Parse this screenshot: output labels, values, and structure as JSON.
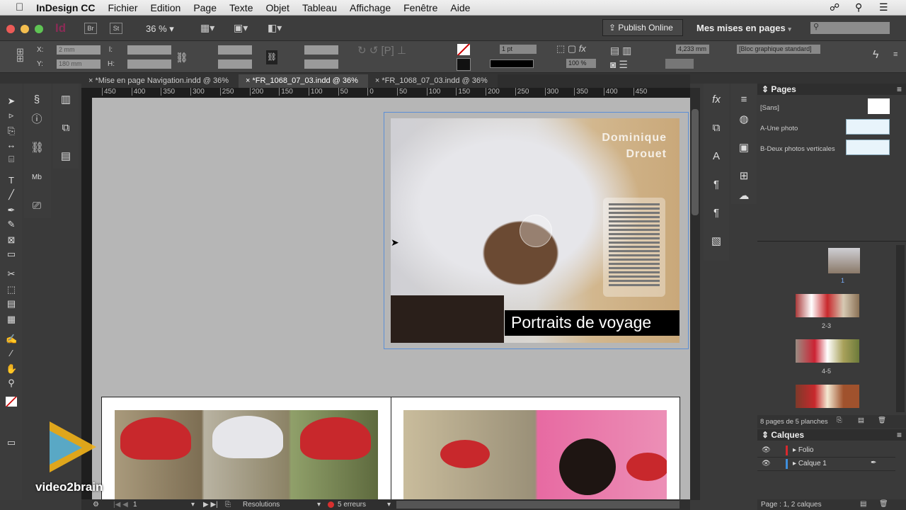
{
  "menubar": {
    "app": "InDesign CC",
    "items": [
      "Fichier",
      "Edition",
      "Page",
      "Texte",
      "Objet",
      "Tableau",
      "Affichage",
      "Fenêtre",
      "Aide"
    ]
  },
  "appbar": {
    "id_logo": "Id",
    "bridge": "Br",
    "stock": "St",
    "zoom": "36 %",
    "publish": "Publish Online",
    "workspace": "Mes mises en pages",
    "search_placeholder": ""
  },
  "control": {
    "x_label": "X:",
    "x": "2 mm",
    "y_label": "Y:",
    "y": "180 mm",
    "w_label": "l:",
    "h_label": "H:",
    "stroke_weight": "1 pt",
    "opacity": "100 %",
    "offset": "4,233 mm",
    "object_style": "[Bloc graphique standard]"
  },
  "tabs": [
    {
      "label": "*Mise en page Navigation.indd @ 36%",
      "active": false
    },
    {
      "label": "*FR_1068_07_03.indd @ 36%",
      "active": true
    },
    {
      "label": "*FR_1068_07_03.indd @ 36%",
      "active": false
    }
  ],
  "ruler": [
    "450",
    "400",
    "350",
    "300",
    "250",
    "200",
    "150",
    "100",
    "50",
    "0",
    "50",
    "100",
    "150",
    "200",
    "250",
    "300",
    "350",
    "400",
    "450"
  ],
  "document": {
    "author_first": "Dominique",
    "author_last": "Drouet",
    "title": "Portraits de voyage"
  },
  "pages_panel": {
    "title": "Pages",
    "masters": [
      "[Sans]",
      "A-Une photo",
      "B-Deux photos verticales"
    ],
    "page_labels": [
      "1",
      "2-3",
      "4-5"
    ],
    "summary": "8 pages de 5 planches"
  },
  "layers_panel": {
    "title": "Calques",
    "layers": [
      {
        "name": "Folio",
        "color": "#d8282e"
      },
      {
        "name": "Calque 1",
        "color": "#3f8fdc"
      }
    ],
    "summary": "Page : 1, 2 calques"
  },
  "status": {
    "page": "1",
    "preflight_profile": "Resolutions",
    "errors": "5 erreurs"
  },
  "watermark": {
    "text": "video2brain"
  }
}
